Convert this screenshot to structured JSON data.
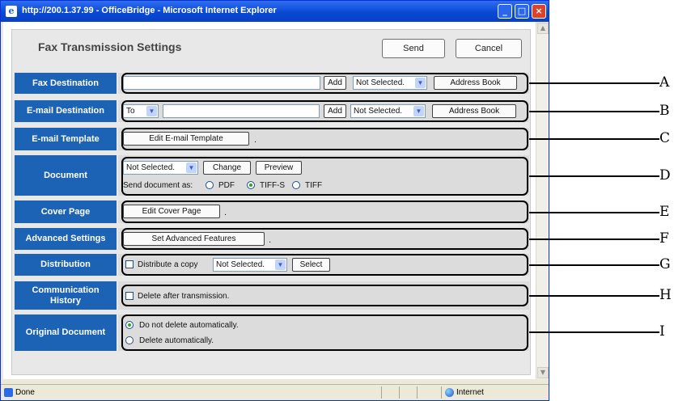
{
  "window": {
    "title": "http://200.1.37.99 - OfficeBridge - Microsoft Internet Explorer",
    "minimize": "_",
    "maximize": "□",
    "close": "×"
  },
  "status": {
    "text": "Done",
    "zone": "Internet"
  },
  "page": {
    "title": "Fax Transmission Settings",
    "send_label": "Send",
    "cancel_label": "Cancel"
  },
  "rows": {
    "fax_destination": {
      "label": "Fax Destination",
      "add": "Add",
      "select": "Not Selected.",
      "address_book": "Address Book"
    },
    "email_destination": {
      "label": "E-mail Destination",
      "to_select": "To",
      "add": "Add",
      "select": "Not Selected.",
      "address_book": "Address Book"
    },
    "email_template": {
      "label": "E-mail Template",
      "button": "Edit E-mail Template",
      "dot": "."
    },
    "document": {
      "label": "Document",
      "select": "Not Selected.",
      "change": "Change",
      "preview": "Preview",
      "send_as": "Send document as:",
      "opt_pdf": "PDF",
      "opt_tiffs": "TIFF-S",
      "opt_tiff": "TIFF",
      "selected_format": "TIFF-S"
    },
    "cover_page": {
      "label": "Cover Page",
      "button": "Edit Cover Page",
      "dot": "."
    },
    "advanced_settings": {
      "label": "Advanced Settings",
      "button": "Set Advanced Features",
      "dot": "."
    },
    "distribution": {
      "label": "Distribution",
      "checkbox_label": "Distribute a copy",
      "select": "Not Selected.",
      "button": "Select"
    },
    "communication_history": {
      "label": "Communication History",
      "checkbox_label": "Delete after transmission."
    },
    "original_document": {
      "label": "Original Document",
      "opt1": "Do not delete automatically.",
      "opt2": "Delete automatically.",
      "selected": "Do not delete automatically."
    }
  },
  "callouts": [
    "A",
    "B",
    "C",
    "D",
    "E",
    "F",
    "G",
    "H",
    "I"
  ]
}
